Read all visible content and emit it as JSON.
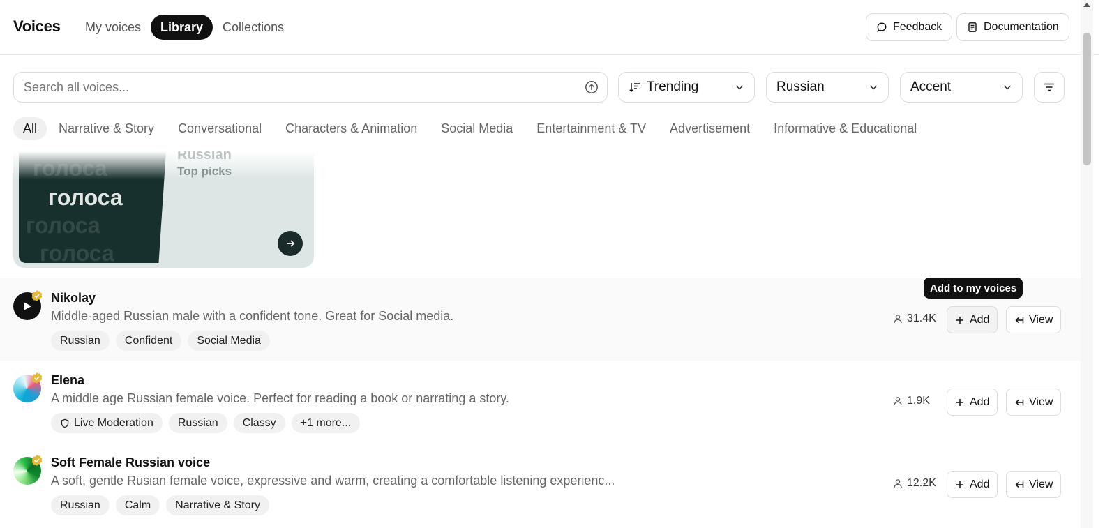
{
  "header": {
    "title": "Voices",
    "tabs": [
      {
        "label": "My voices"
      },
      {
        "label": "Library"
      },
      {
        "label": "Collections"
      }
    ],
    "feedback_label": "Feedback",
    "documentation_label": "Documentation"
  },
  "search": {
    "placeholder": "Search all voices...",
    "sort": "Trending",
    "language": "Russian",
    "accent": "Accent"
  },
  "categories": [
    "All",
    "Narrative & Story",
    "Conversational",
    "Characters & Animation",
    "Social Media",
    "Entertainment & TV",
    "Advertisement",
    "Informative & Educational"
  ],
  "collection": {
    "art_word": "голоса",
    "title": "Russian",
    "subtitle": "Top picks"
  },
  "tooltip": "Add to my voices",
  "voices": [
    {
      "name": "Nikolay",
      "description": "Middle-aged Russian male with a confident tone. Great for Social media.",
      "tags": [
        "Russian",
        "Confident",
        "Social Media"
      ],
      "uses": "31.4K",
      "add_label": "Add",
      "view_label": "View"
    },
    {
      "name": "Elena",
      "description": "A middle age Russian female voice. Perfect for reading a book or narrating a story.",
      "moderation_tag": "Live Moderation",
      "tags": [
        "Russian",
        "Classy",
        "+1 more..."
      ],
      "uses": "1.9K",
      "add_label": "Add",
      "view_label": "View"
    },
    {
      "name": "Soft Female Russian voice",
      "description": "A soft, gentle Rusian female voice, expressive and warm, creating a comfortable listening experienc...",
      "tags": [
        "Russian",
        "Calm",
        "Narrative & Story"
      ],
      "uses": "12.2K",
      "add_label": "Add",
      "view_label": "View"
    }
  ],
  "colors": {
    "accent": "#111111",
    "badge": "#e2b93b",
    "chip_bg": "#f1f1f1",
    "collection_bg": "#dde6e5"
  }
}
